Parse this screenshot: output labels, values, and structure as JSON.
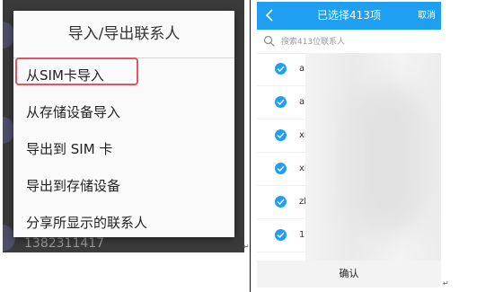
{
  "left": {
    "peek_number": "1382311417",
    "dialog": {
      "title": "导入/导出联系人",
      "items": [
        {
          "label": "从SIM卡导入",
          "highlighted": true
        },
        {
          "label": "从存储设备导入"
        },
        {
          "label": "导出到 SIM 卡"
        },
        {
          "label": "导出到存储设备"
        },
        {
          "label": "分享所显示的联系人"
        }
      ]
    },
    "highlight_color": "#e05563"
  },
  "right": {
    "header": {
      "back_icon": "chevron-left-icon",
      "title": "已选择413项",
      "cancel_label": "取消",
      "color": "#1e9ff2"
    },
    "search": {
      "placeholder": "搜索413位联系人",
      "value": "",
      "icon": "search-icon"
    },
    "contacts": [
      {
        "name_fragment": "a",
        "checked": true
      },
      {
        "name_fragment": "a",
        "checked": true
      },
      {
        "name_fragment": "xi",
        "checked": true
      },
      {
        "name_fragment": "xi",
        "checked": true
      },
      {
        "name_fragment": "zh",
        "checked": true
      },
      {
        "name_fragment": "1:",
        "checked": true
      }
    ],
    "confirm_label": "确认"
  },
  "marks": {
    "paragraph_mark": "↵"
  }
}
